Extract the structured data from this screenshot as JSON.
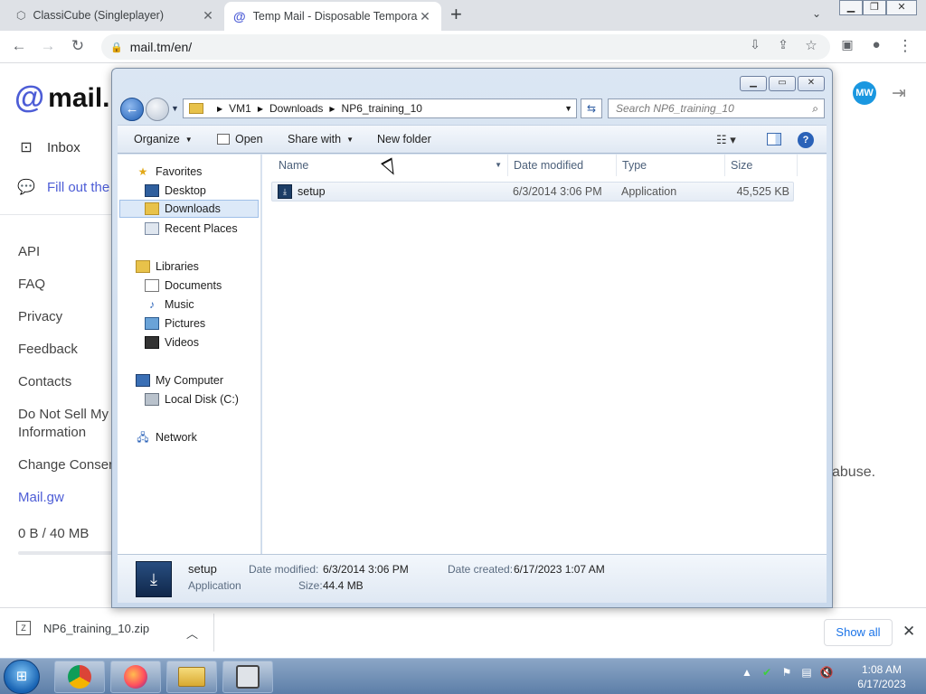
{
  "browser": {
    "tabs": [
      {
        "title": "ClassiCube (Singleplayer)",
        "active": false
      },
      {
        "title": "Temp Mail - Disposable Temporary",
        "active": true
      }
    ],
    "url": "mail.tm/en/"
  },
  "mailtm": {
    "logo_text": "mail.",
    "nav": [
      {
        "label": "Inbox",
        "icon": "inbox-icon"
      },
      {
        "label": "Fill out the",
        "icon": "chat-icon"
      }
    ],
    "links": [
      "API",
      "FAQ",
      "Privacy",
      "Feedback",
      "Contacts",
      "Do Not Sell My Information",
      "Change Conser"
    ],
    "mail_gw": "Mail.gw",
    "storage": "0 B  / 40 MB",
    "storage_fraction": 0.0,
    "avatar_initials": "MW",
    "body_fragment": "abuse."
  },
  "download_bar": {
    "file": "NP6_training_10.zip",
    "show_all": "Show all"
  },
  "explorer": {
    "breadcrumb": [
      "VM1",
      "Downloads",
      "NP6_training_10"
    ],
    "search_placeholder": "Search NP6_training_10",
    "commands": {
      "organize": "Organize",
      "open": "Open",
      "share": "Share with",
      "new_folder": "New folder"
    },
    "nav_pane": {
      "favorites": "Favorites",
      "favorites_items": [
        "Desktop",
        "Downloads",
        "Recent Places"
      ],
      "libraries": "Libraries",
      "libraries_items": [
        "Documents",
        "Music",
        "Pictures",
        "Videos"
      ],
      "computer": "My Computer",
      "computer_items": [
        "Local Disk (C:)"
      ],
      "network": "Network"
    },
    "columns": [
      "Name",
      "Date modified",
      "Type",
      "Size"
    ],
    "files": [
      {
        "name": "setup",
        "date_modified": "6/3/2014 3:06 PM",
        "type": "Application",
        "size": "45,525 KB"
      }
    ],
    "details": {
      "name": "setup",
      "type": "Application",
      "date_modified_label": "Date modified:",
      "date_modified": "6/3/2014 3:06 PM",
      "size_label": "Size:",
      "size": "44.4 MB",
      "date_created_label": "Date created:",
      "date_created": "6/17/2023 1:07 AM"
    }
  },
  "taskbar": {
    "time": "1:08 AM",
    "date": "6/17/2023"
  }
}
